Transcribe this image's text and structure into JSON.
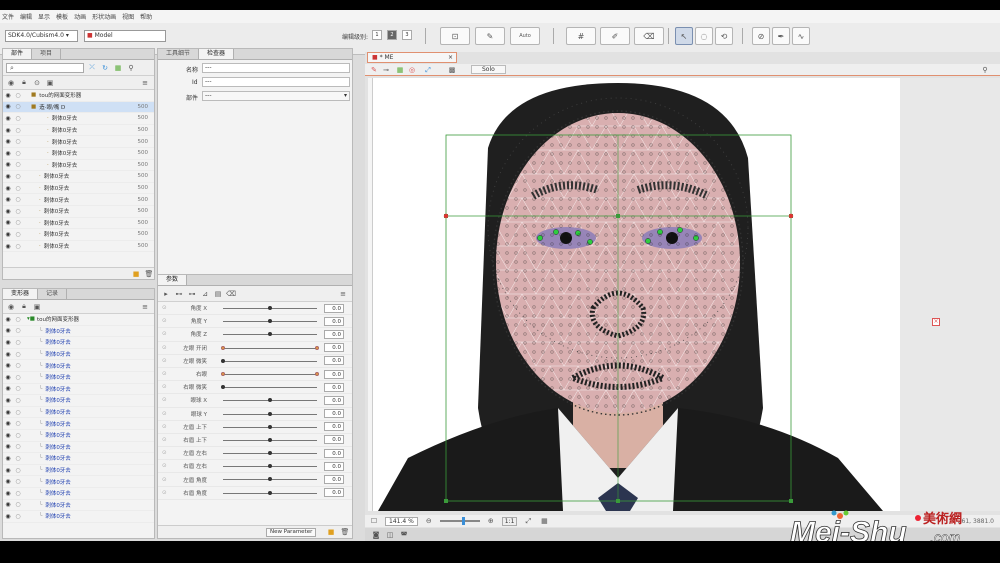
{
  "menu": [
    "文件",
    "编辑",
    "显示",
    "模板",
    "动画",
    "形状动画",
    "视图",
    "帮助"
  ],
  "toolbar": {
    "sdk_select": "SDK4.0/Cubism4.0",
    "model_select": "Model",
    "level_label": "编辑级别:",
    "levels": [
      "1",
      "2",
      "3"
    ],
    "auto_label": "Auto"
  },
  "parts_panel": {
    "tabs": [
      "部件",
      "项目"
    ],
    "rows": [
      {
        "label": "tou的网面变形器",
        "val": "",
        "indent": 1
      },
      {
        "label": "造·眼/嘴 D",
        "val": "500",
        "indent": 1,
        "selected": true
      },
      {
        "label": "刺体0牙去",
        "val": "500",
        "indent": 3
      },
      {
        "label": "刺体0牙去",
        "val": "500",
        "indent": 3
      },
      {
        "label": "刺体0牙去",
        "val": "500",
        "indent": 3
      },
      {
        "label": "刺体0牙去",
        "val": "500",
        "indent": 3
      },
      {
        "label": "刺体0牙去",
        "val": "500",
        "indent": 3
      },
      {
        "label": "刺体0牙去",
        "val": "500",
        "indent": 2
      },
      {
        "label": "刺体0牙去",
        "val": "500",
        "indent": 2
      },
      {
        "label": "刺体0牙去",
        "val": "500",
        "indent": 2
      },
      {
        "label": "刺体0牙去",
        "val": "500",
        "indent": 2
      },
      {
        "label": "刺体0牙去",
        "val": "500",
        "indent": 2
      },
      {
        "label": "刺体0牙去",
        "val": "500",
        "indent": 2
      },
      {
        "label": "刺体0牙去",
        "val": "500",
        "indent": 2
      }
    ]
  },
  "inspector": {
    "tabs": [
      "工具细节",
      "检查器"
    ],
    "name_label": "名称",
    "name_value": "---",
    "id_label": "Id",
    "id_value": "---",
    "part_label": "部件",
    "part_value": "---"
  },
  "deformer_panel": {
    "tabs": [
      "变形器",
      "记录"
    ],
    "root": "tou的网面变形器",
    "rows": [
      "刺体0牙去",
      "刺体0牙去",
      "刺体0牙去",
      "刺体0牙去",
      "刺体0牙去",
      "刺体0牙去",
      "刺体0牙去",
      "刺体0牙去",
      "刺体0牙去",
      "刺体0牙去",
      "刺体0牙去",
      "刺体0牙去",
      "刺体0牙去",
      "刺体0牙去",
      "刺体0牙去",
      "刺体0牙去",
      "刺体0牙去"
    ]
  },
  "params_panel": {
    "tab": "参数",
    "rows": [
      {
        "name": "角度 X",
        "value": "0.0",
        "pos": 0.5,
        "orange": false
      },
      {
        "name": "角度 Y",
        "value": "0.0",
        "pos": 0.5,
        "orange": false
      },
      {
        "name": "角度 Z",
        "value": "0.0",
        "pos": 0.5,
        "orange": false
      },
      {
        "name": "左眼 开闭",
        "value": "0.0",
        "pos": 0.0,
        "orange": true
      },
      {
        "name": "左眼 微笑",
        "value": "0.0",
        "pos": 0.0,
        "orange": false
      },
      {
        "name": "右眼",
        "value": "0.0",
        "pos": 0.0,
        "orange": true
      },
      {
        "name": "右眼 微笑",
        "value": "0.0",
        "pos": 0.0,
        "orange": false
      },
      {
        "name": "眼球 X",
        "value": "0.0",
        "pos": 0.5,
        "orange": false
      },
      {
        "name": "眼球 Y",
        "value": "0.0",
        "pos": 0.5,
        "orange": false
      },
      {
        "name": "左眉 上下",
        "value": "0.0",
        "pos": 0.5,
        "orange": false
      },
      {
        "name": "右眉 上下",
        "value": "0.0",
        "pos": 0.5,
        "orange": false
      },
      {
        "name": "左眉 左右",
        "value": "0.0",
        "pos": 0.5,
        "orange": false
      },
      {
        "name": "右眉 左右",
        "value": "0.0",
        "pos": 0.5,
        "orange": false
      },
      {
        "name": "左眉 角度",
        "value": "0.0",
        "pos": 0.5,
        "orange": false
      },
      {
        "name": "右眉 角度",
        "value": "0.0",
        "pos": 0.5,
        "orange": false
      }
    ],
    "new_param": "New Parameter"
  },
  "viewport": {
    "tab_title": "* ME",
    "solo": "Solo",
    "zoom": "141.4 %",
    "ratio": "1:1",
    "coords": "261, 3881.0"
  },
  "watermark": {
    "text": "Mei-Shu.com",
    "cn": "美術網"
  }
}
